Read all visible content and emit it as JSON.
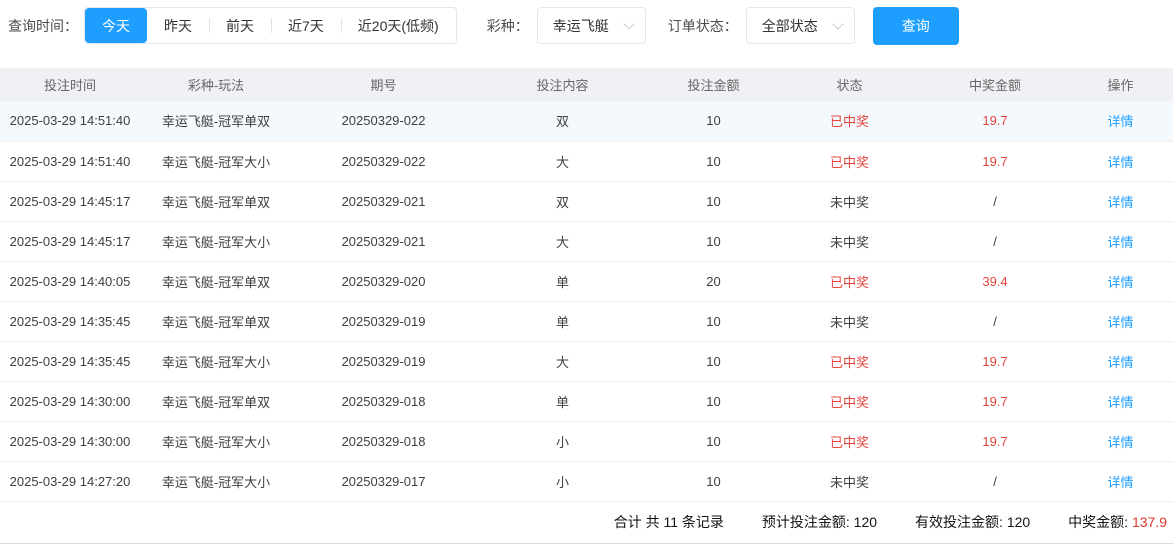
{
  "accent_color": "#1e9fff",
  "filters": {
    "time_label": "查询时间：",
    "time_options": [
      {
        "label": "今天",
        "active": true
      },
      {
        "label": "昨天",
        "active": false
      },
      {
        "label": "前天",
        "active": false
      },
      {
        "label": "近7天",
        "active": false
      },
      {
        "label": "近20天(低频)",
        "active": false
      }
    ],
    "lottery_label": "彩种：",
    "lottery_value": "幸运飞艇",
    "status_label": "订单状态：",
    "status_value": "全部状态",
    "query_button": "查询"
  },
  "table": {
    "columns": [
      "投注时间",
      "彩种-玩法",
      "期号",
      "投注内容",
      "投注金额",
      "状态",
      "中奖金额",
      "操作"
    ],
    "action_label": "详情",
    "rows": [
      {
        "time": "2025-03-29 14:51:40",
        "game": "幸运飞艇-冠军单双",
        "issue": "20250329-022",
        "content": "双",
        "amount": "10",
        "status": "已中奖",
        "won": true,
        "win_amount": "19.7",
        "highlighted": true
      },
      {
        "time": "2025-03-29 14:51:40",
        "game": "幸运飞艇-冠军大小",
        "issue": "20250329-022",
        "content": "大",
        "amount": "10",
        "status": "已中奖",
        "won": true,
        "win_amount": "19.7",
        "highlighted": false
      },
      {
        "time": "2025-03-29 14:45:17",
        "game": "幸运飞艇-冠军单双",
        "issue": "20250329-021",
        "content": "双",
        "amount": "10",
        "status": "未中奖",
        "won": false,
        "win_amount": "/",
        "highlighted": false
      },
      {
        "time": "2025-03-29 14:45:17",
        "game": "幸运飞艇-冠军大小",
        "issue": "20250329-021",
        "content": "大",
        "amount": "10",
        "status": "未中奖",
        "won": false,
        "win_amount": "/",
        "highlighted": false
      },
      {
        "time": "2025-03-29 14:40:05",
        "game": "幸运飞艇-冠军单双",
        "issue": "20250329-020",
        "content": "单",
        "amount": "20",
        "status": "已中奖",
        "won": true,
        "win_amount": "39.4",
        "highlighted": false
      },
      {
        "time": "2025-03-29 14:35:45",
        "game": "幸运飞艇-冠军单双",
        "issue": "20250329-019",
        "content": "单",
        "amount": "10",
        "status": "未中奖",
        "won": false,
        "win_amount": "/",
        "highlighted": false
      },
      {
        "time": "2025-03-29 14:35:45",
        "game": "幸运飞艇-冠军大小",
        "issue": "20250329-019",
        "content": "大",
        "amount": "10",
        "status": "已中奖",
        "won": true,
        "win_amount": "19.7",
        "highlighted": false
      },
      {
        "time": "2025-03-29 14:30:00",
        "game": "幸运飞艇-冠军单双",
        "issue": "20250329-018",
        "content": "单",
        "amount": "10",
        "status": "已中奖",
        "won": true,
        "win_amount": "19.7",
        "highlighted": false
      },
      {
        "time": "2025-03-29 14:30:00",
        "game": "幸运飞艇-冠军大小",
        "issue": "20250329-018",
        "content": "小",
        "amount": "10",
        "status": "已中奖",
        "won": true,
        "win_amount": "19.7",
        "highlighted": false
      },
      {
        "time": "2025-03-29 14:27:20",
        "game": "幸运飞艇-冠军大小",
        "issue": "20250329-017",
        "content": "小",
        "amount": "10",
        "status": "未中奖",
        "won": false,
        "win_amount": "/",
        "highlighted": false
      }
    ]
  },
  "summary": {
    "total_records": "合计 共 11 条记录",
    "expected_label": "预计投注金额:",
    "expected_value": "120",
    "valid_label": "有效投注金额:",
    "valid_value": "120",
    "win_label": "中奖金额:",
    "win_value": "137.9"
  }
}
